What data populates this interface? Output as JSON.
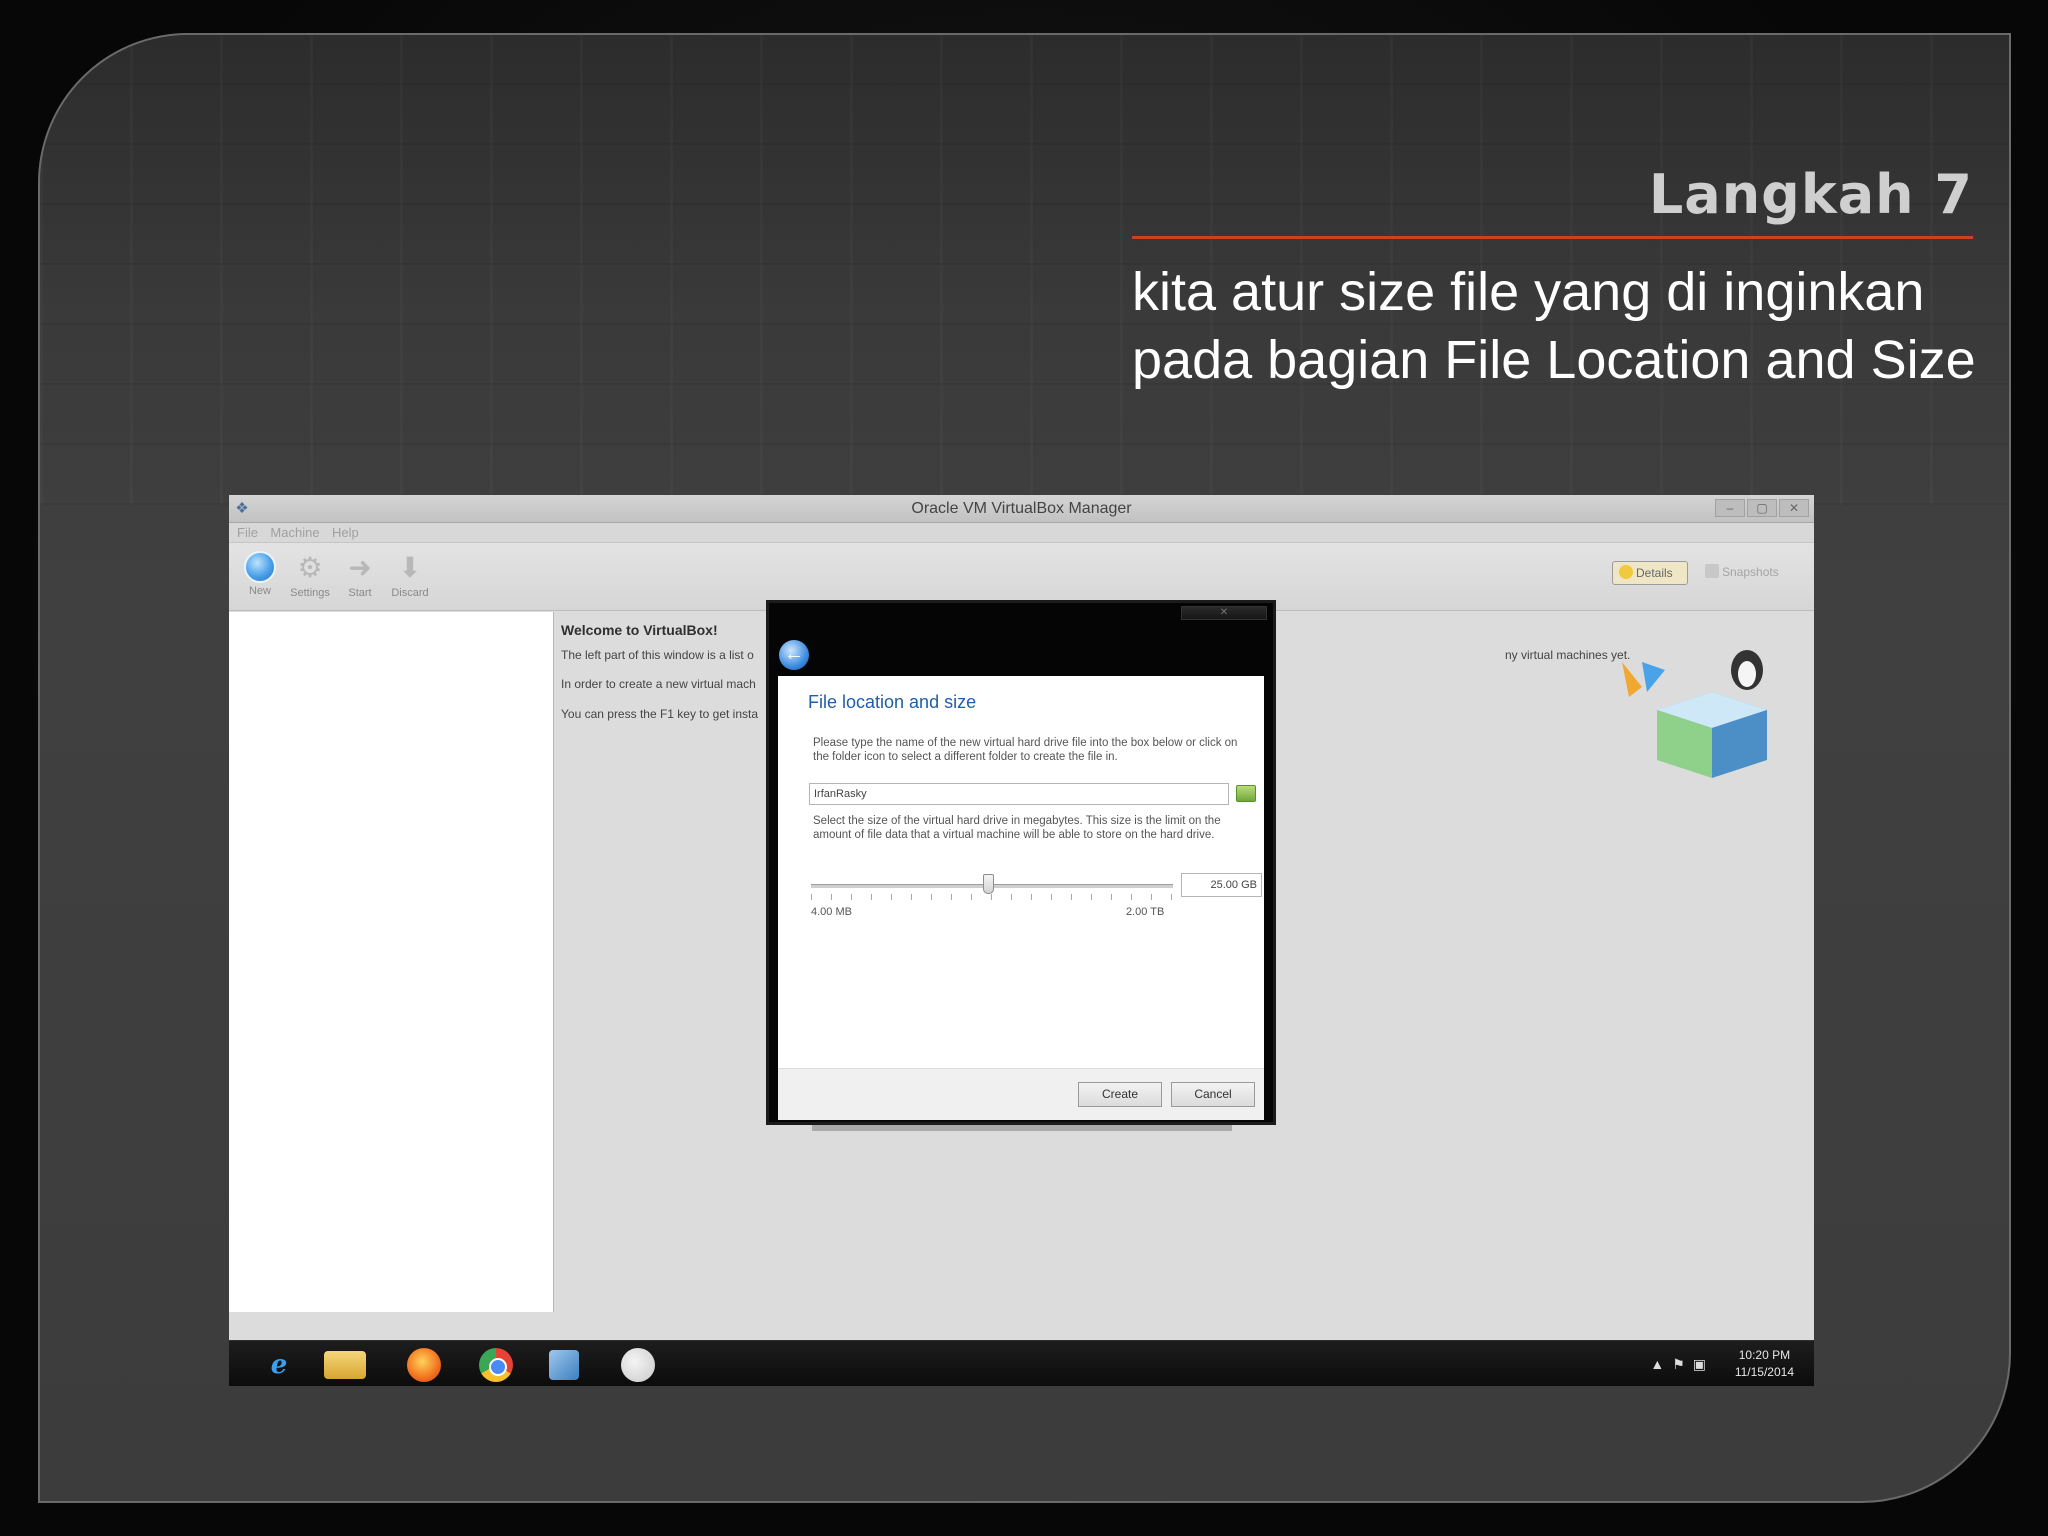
{
  "slide": {
    "title": "Langkah 7",
    "body": "kita atur size file yang di inginkan pada bagian File Location and Size"
  },
  "vbox": {
    "window_title": "Oracle VM VirtualBox Manager",
    "menu": [
      "File",
      "Machine",
      "Help"
    ],
    "toolbar": {
      "new": "New",
      "settings": "Settings",
      "start": "Start",
      "discard": "Discard"
    },
    "tabs": {
      "details": "Details",
      "snapshots": "Snapshots"
    },
    "welcome": {
      "title": "Welcome to VirtualBox!",
      "line1": "The left part of this window is a list o",
      "line2": "In order to create a new virtual mach",
      "line3": "You can press the F1 key to get insta",
      "line1_tail": "ny virtual machines yet."
    },
    "taskbar": {
      "time": "10:20 PM",
      "date": "11/15/2014"
    }
  },
  "dialog": {
    "heading": "File location and size",
    "text1": "Please type the name of the new virtual hard drive file into the box below or click on the folder icon to select a different folder to create the file in.",
    "file_name": "IrfanRasky",
    "text2": "Select the size of the virtual hard drive in megabytes. This size is the limit on the amount of file data that a virtual machine will be able to store on the hard drive.",
    "size_value": "25.00 GB",
    "range_min": "4.00 MB",
    "range_max": "2.00 TB",
    "slider_fraction": 0.49,
    "create_label": "Create",
    "cancel_label": "Cancel"
  },
  "colors": {
    "accent_rule": "#c6441f",
    "dialog_heading": "#1f5ea8"
  },
  "icons": {
    "new": "new-vm-icon",
    "settings": "gear-icon",
    "start": "start-arrow-icon",
    "discard": "discard-arrow-icon",
    "back": "back-arrow-icon",
    "folder": "folder-icon"
  }
}
